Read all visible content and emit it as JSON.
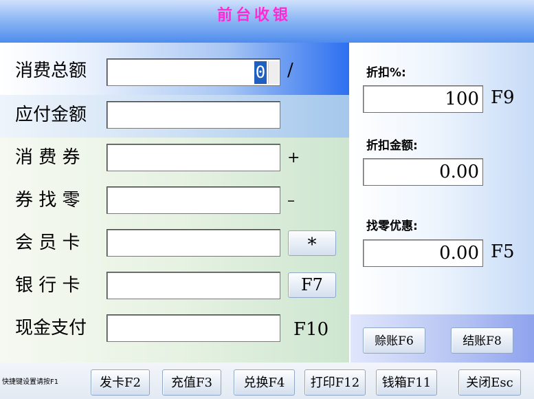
{
  "title": "前台收银",
  "form": {
    "total_label": "消费总额",
    "total_value": "0",
    "total_sym": "/",
    "payable_label": "应付金额",
    "coupon_label": "消 费 券",
    "coupon_sym": "+",
    "change_label": "券 找 零",
    "change_sym": "–",
    "member_label": "会 员 卡",
    "member_btn": "*",
    "bank_label": "银 行 卡",
    "bank_btn": "F7",
    "cash_label": "现金支付",
    "cash_key": "F10"
  },
  "right": {
    "discount_pct_label": "折扣%:",
    "discount_pct_value": "100",
    "discount_pct_key": "F9",
    "discount_amt_label": "折扣金额:",
    "discount_amt_value": "0.00",
    "change_disc_label": "找零优惠:",
    "change_disc_value": "0.00",
    "change_disc_key": "F5",
    "credit_btn": "赊账F6",
    "settle_btn": "结账F8"
  },
  "bottom": {
    "hint": "快捷键设置请按F1",
    "buttons": [
      "发卡F2",
      "充值F3",
      "兑换F4",
      "打印F12",
      "钱箱F11",
      "关闭Esc"
    ]
  },
  "colors": {
    "title": "#ff2ad4",
    "selection": "#1f5fbf"
  }
}
